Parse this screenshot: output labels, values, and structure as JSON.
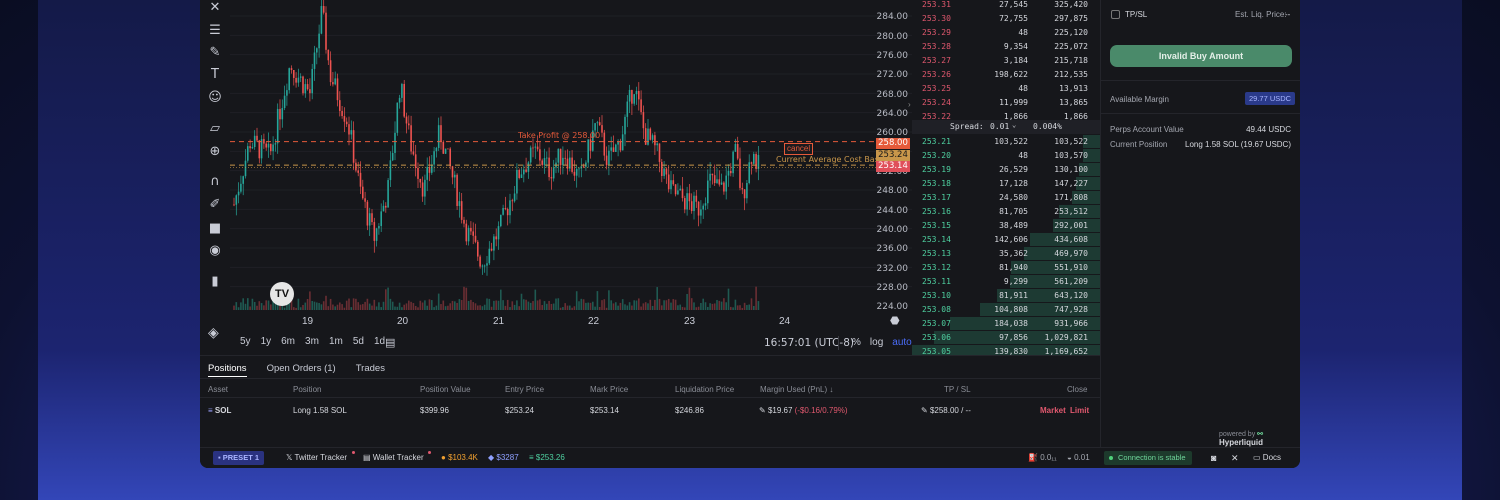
{
  "chart": {
    "y_ticks": [
      "284.00",
      "280.00",
      "276.00",
      "272.00",
      "268.00",
      "264.00",
      "260.00",
      "252.00",
      "248.00",
      "244.00",
      "240.00",
      "236.00",
      "232.00",
      "228.00",
      "224.00"
    ],
    "x_ticks": [
      "19",
      "20",
      "21",
      "22",
      "23",
      "24"
    ],
    "take_profit_label": "Take Profit @ 258.00",
    "cost_basis_label": "Current Average Cost Basis",
    "cancel_label": "cancel",
    "tag_tp": "258.00",
    "tag_last": "253.24",
    "tag_cost": "253.14",
    "ranges": [
      "5y",
      "1y",
      "6m",
      "3m",
      "1m",
      "5d",
      "1d"
    ],
    "time": "16:57:01 (UTC-8)",
    "opt_percent": "%",
    "opt_log": "log",
    "opt_auto": "auto",
    "tv_logo": "TV",
    "colors": {
      "up": "#26a69a",
      "down": "#ef5350",
      "tp": "#e55a3a",
      "cost": "#c8964a",
      "accent": "#4a6cf7"
    }
  },
  "order_book": {
    "asks": [
      {
        "price": "253.31",
        "size": "27,545",
        "total": "325,420"
      },
      {
        "price": "253.30",
        "size": "72,755",
        "total": "297,875"
      },
      {
        "price": "253.29",
        "size": "48",
        "total": "225,120"
      },
      {
        "price": "253.28",
        "size": "9,354",
        "total": "225,072"
      },
      {
        "price": "253.27",
        "size": "3,184",
        "total": "215,718"
      },
      {
        "price": "253.26",
        "size": "198,622",
        "total": "212,535"
      },
      {
        "price": "253.25",
        "size": "48",
        "total": "13,913"
      },
      {
        "price": "253.24",
        "size": "11,999",
        "total": "13,865"
      },
      {
        "price": "253.22",
        "size": "1,866",
        "total": "1,866"
      }
    ],
    "spread_label": "Spread:",
    "spread_value": "0.01",
    "spread_pct": "0.004%",
    "bids": [
      {
        "price": "253.21",
        "size": "103,522",
        "total": "103,522"
      },
      {
        "price": "253.20",
        "size": "48",
        "total": "103,570"
      },
      {
        "price": "253.19",
        "size": "26,529",
        "total": "130,100"
      },
      {
        "price": "253.18",
        "size": "17,128",
        "total": "147,227"
      },
      {
        "price": "253.17",
        "size": "24,580",
        "total": "171,808"
      },
      {
        "price": "253.16",
        "size": "81,705",
        "total": "253,512"
      },
      {
        "price": "253.15",
        "size": "38,489",
        "total": "292,001"
      },
      {
        "price": "253.14",
        "size": "142,606",
        "total": "434,608"
      },
      {
        "price": "253.13",
        "size": "35,362",
        "total": "469,970"
      },
      {
        "price": "253.12",
        "size": "81,940",
        "total": "551,910"
      },
      {
        "price": "253.11",
        "size": "9,299",
        "total": "561,209"
      },
      {
        "price": "253.10",
        "size": "81,911",
        "total": "643,120"
      },
      {
        "price": "253.08",
        "size": "104,808",
        "total": "747,928"
      },
      {
        "price": "253.07",
        "size": "184,038",
        "total": "931,966"
      },
      {
        "price": "253.06",
        "size": "97,856",
        "total": "1,029,821"
      },
      {
        "price": "253.05",
        "size": "139,830",
        "total": "1,169,652"
      }
    ]
  },
  "panel": {
    "tpsl_label": "TP/SL",
    "liq_label": "Est. Liq. Price:",
    "liq_value": "--",
    "buy_button": "Invalid Buy Amount",
    "available_margin_label": "Available Margin",
    "available_margin_value": "29.77 USDC",
    "perps_value_label": "Perps Account Value",
    "perps_value": "49.44 USDC",
    "position_label": "Current Position",
    "position_value": "Long 1.58 SOL (19.67 USDC)",
    "powered_by": "powered by",
    "powered_brand": "Hyperliquid"
  },
  "positions": {
    "tabs": [
      "Positions",
      "Open Orders (1)",
      "Trades"
    ],
    "headers": [
      "Asset",
      "Position",
      "Position Value",
      "Entry Price",
      "Mark Price",
      "Liquidation Price",
      "Margin Used (PnL) ↓",
      "TP / SL",
      "Close"
    ],
    "row": {
      "asset": "SOL",
      "position": "Long 1.58 SOL",
      "value": "$399.96",
      "entry": "$253.24",
      "mark": "$253.14",
      "liq": "$246.86",
      "margin": "$19.67",
      "pnl": "(-$0.16/0.79%)",
      "tpsl": "$258.00 / --",
      "close_market": "Market",
      "close_limit": "Limit"
    }
  },
  "footer": {
    "preset": "PRESET 1",
    "twitter": "Twitter Tracker",
    "wallet": "Wallet Tracker",
    "btc": "$103.4K",
    "eth": "$3287",
    "sol": "$253.26",
    "stat1": "0.0₁₁",
    "stat2": "0.01",
    "connection": "Connection is stable",
    "docs": "Docs"
  }
}
